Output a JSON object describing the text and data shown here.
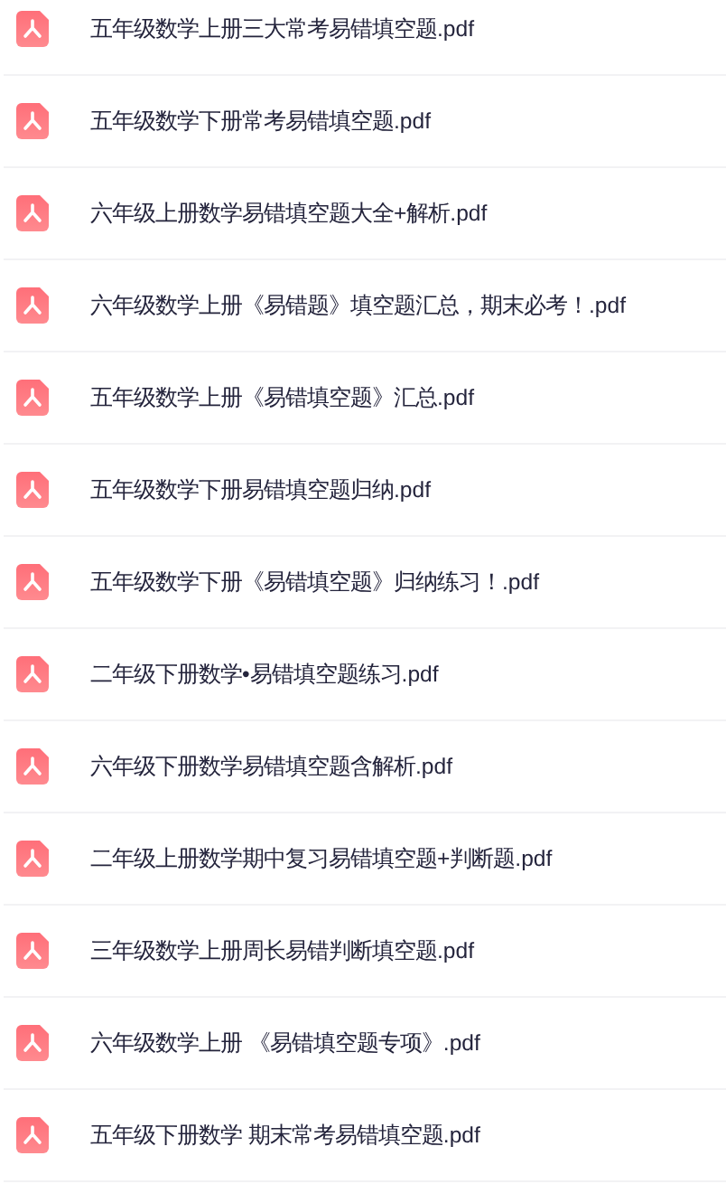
{
  "files": [
    {
      "name": "五年级数学上册三大常考易错填空题.pdf"
    },
    {
      "name": "五年级数学下册常考易错填空题.pdf"
    },
    {
      "name": "六年级上册数学易错填空题大全+解析.pdf"
    },
    {
      "name": "六年级数学上册《易错题》填空题汇总，期末必考！.pdf"
    },
    {
      "name": "五年级数学上册《易错填空题》汇总.pdf"
    },
    {
      "name": "五年级数学下册易错填空题归纳.pdf"
    },
    {
      "name": "五年级数学下册《易错填空题》归纳练习！.pdf"
    },
    {
      "name": "二年级下册数学•易错填空题练习.pdf"
    },
    {
      "name": "六年级下册数学易错填空题含解析.pdf"
    },
    {
      "name": "二年级上册数学期中复习易错填空题+判断题.pdf"
    },
    {
      "name": "三年级数学上册周长易错判断填空题.pdf"
    },
    {
      "name": "六年级数学上册 《易错填空题专项》.pdf"
    },
    {
      "name": "五年级下册数学 期末常考易错填空题.pdf"
    }
  ]
}
